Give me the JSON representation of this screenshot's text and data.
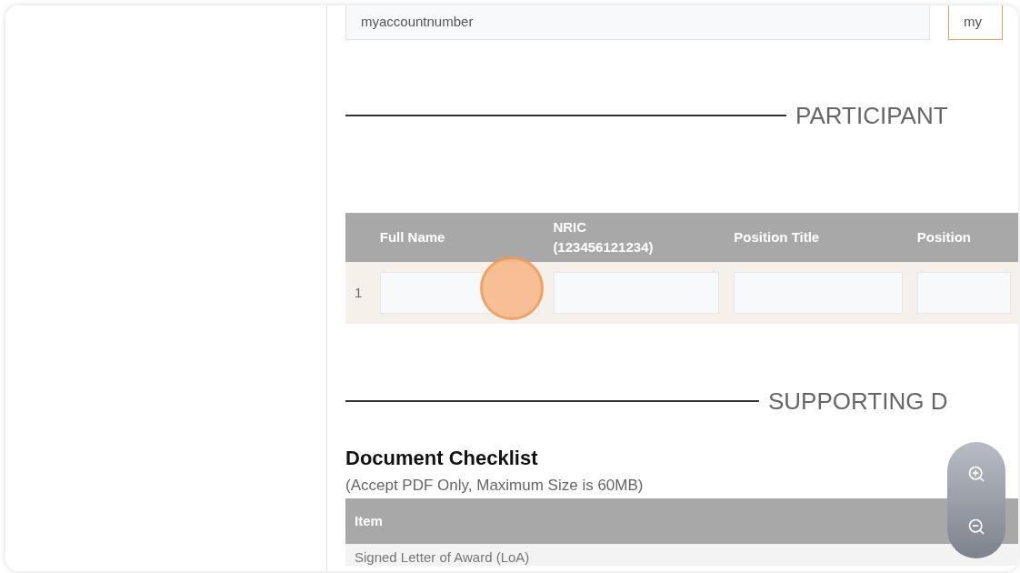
{
  "account_fields": [
    {
      "value": "myaccountnumber",
      "focused": false
    },
    {
      "value": "my",
      "focused": true
    }
  ],
  "participant_section": {
    "heading": "PARTICIPANT",
    "columns": [
      "Full Name",
      "NRIC (123456121234)",
      "Position Title",
      "Position"
    ],
    "rows": [
      {
        "index": "1"
      }
    ]
  },
  "supporting_section": {
    "heading": "SUPPORTING D",
    "checklist_title": "Document Checklist",
    "checklist_note": "(Accept PDF Only, Maximum Size is 60MB)",
    "columns": [
      "Item"
    ],
    "rows": [
      "Signed Letter of Award (LoA)"
    ]
  },
  "tap_indicator": true
}
